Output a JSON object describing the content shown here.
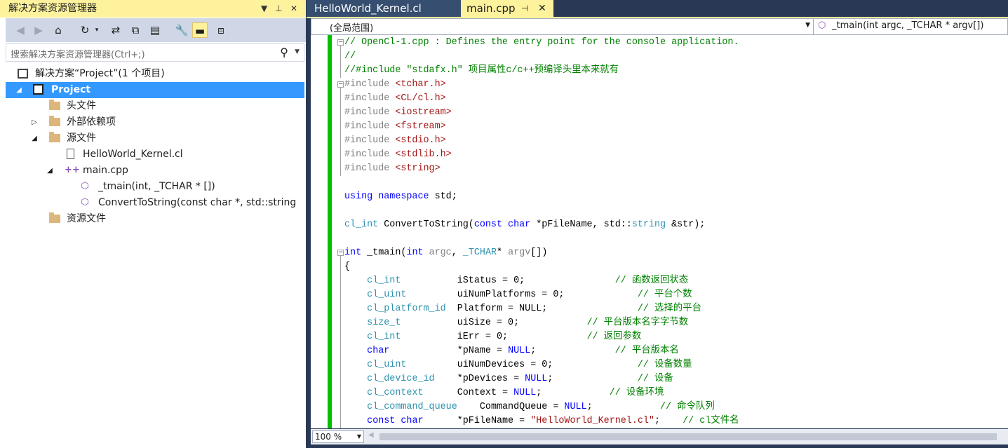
{
  "solution_explorer": {
    "title": "解决方案资源管理器",
    "search_placeholder": "搜索解决方案资源管理器(Ctrl+;)",
    "toolbar_icons": [
      "back-icon",
      "forward-icon",
      "home-icon",
      "history-icon",
      "sync-icon",
      "collapse-all-icon",
      "show-all-files-icon",
      "properties-icon",
      "preview-icon",
      "class-view-icon"
    ],
    "tree": {
      "solution": "解决方案“Project”(1 个项目)",
      "project": "Project",
      "header_files": "头文件",
      "external_deps": "外部依赖项",
      "source_files": "源文件",
      "kernel_file": "HelloWorld_Kernel.cl",
      "main_file": "main.cpp",
      "func_tmain": "_tmain(int, _TCHAR * [])",
      "func_convert": "ConvertToString(const char *, std::string",
      "resource_files": "资源文件"
    }
  },
  "editor": {
    "tabs": [
      {
        "label": "HelloWorld_Kernel.cl",
        "active": false
      },
      {
        "label": "main.cpp",
        "active": true
      }
    ],
    "scope": "(全局范围)",
    "member": "_tmain(int argc, _TCHAR * argv[])",
    "zoom": "100 %"
  },
  "colors": {
    "accent_yellow": "#fff29d",
    "background": "#293955",
    "selection": "#3399ff",
    "change_margin": "#00c000"
  },
  "code_lines": [
    [
      [
        "c",
        "// OpenCl-1.cpp : Defines the entry point for the console application."
      ]
    ],
    [
      [
        "c",
        "//"
      ]
    ],
    [
      [
        "c",
        "//#include \"stdafx.h\" 项目属性c/c++预编译头里本来就有"
      ]
    ],
    [
      [
        "p",
        "#include "
      ],
      [
        "s",
        "<tchar.h>"
      ]
    ],
    [
      [
        "p",
        "#include "
      ],
      [
        "s",
        "<CL/cl.h>"
      ]
    ],
    [
      [
        "p",
        "#include "
      ],
      [
        "s",
        "<iostream>"
      ]
    ],
    [
      [
        "p",
        "#include "
      ],
      [
        "s",
        "<fstream>"
      ]
    ],
    [
      [
        "p",
        "#include "
      ],
      [
        "s",
        "<stdio.h>"
      ]
    ],
    [
      [
        "p",
        "#include "
      ],
      [
        "s",
        "<stdlib.h>"
      ]
    ],
    [
      [
        "p",
        "#include "
      ],
      [
        "s",
        "<string>"
      ]
    ],
    [],
    [
      [
        "k",
        "using namespace"
      ],
      [
        "n",
        " std;"
      ]
    ],
    [],
    [
      [
        "t",
        "cl_int"
      ],
      [
        "n",
        " ConvertToString("
      ],
      [
        "k",
        "const char"
      ],
      [
        "n",
        " *pFileName, std::"
      ],
      [
        "t",
        "string"
      ],
      [
        "n",
        " &str);"
      ]
    ],
    [],
    [
      [
        "k",
        "int"
      ],
      [
        "n",
        " _tmain("
      ],
      [
        "k",
        "int"
      ],
      [
        "n",
        " "
      ],
      [
        "p",
        "argc"
      ],
      [
        "n",
        ", "
      ],
      [
        "t",
        "_TCHAR"
      ],
      [
        "n",
        "* "
      ],
      [
        "p",
        "argv"
      ],
      [
        "n",
        "[])"
      ]
    ],
    [
      [
        "n",
        "{"
      ]
    ],
    [
      [
        "n",
        "    "
      ],
      [
        "t",
        "cl_int"
      ],
      [
        "n",
        "          iStatus = 0;                "
      ],
      [
        "c",
        "// 函数返回状态"
      ]
    ],
    [
      [
        "n",
        "    "
      ],
      [
        "t",
        "cl_uint"
      ],
      [
        "n",
        "         uiNumPlatforms = 0;             "
      ],
      [
        "c",
        "// 平台个数"
      ]
    ],
    [
      [
        "n",
        "    "
      ],
      [
        "t",
        "cl_platform_id"
      ],
      [
        "n",
        "  Platform = NULL;                "
      ],
      [
        "c",
        "// 选择的平台"
      ]
    ],
    [
      [
        "n",
        "    "
      ],
      [
        "t",
        "size_t"
      ],
      [
        "n",
        "          uiSize = 0;            "
      ],
      [
        "c",
        "// 平台版本名字字节数"
      ]
    ],
    [
      [
        "n",
        "    "
      ],
      [
        "t",
        "cl_int"
      ],
      [
        "n",
        "          iErr = 0;              "
      ],
      [
        "c",
        "// 返回参数"
      ]
    ],
    [
      [
        "n",
        "    "
      ],
      [
        "k",
        "char"
      ],
      [
        "n",
        "            *pName = "
      ],
      [
        "k",
        "NULL"
      ],
      [
        "n",
        ";              "
      ],
      [
        "c",
        "// 平台版本名"
      ]
    ],
    [
      [
        "n",
        "    "
      ],
      [
        "t",
        "cl_uint"
      ],
      [
        "n",
        "         uiNumDevices = 0;               "
      ],
      [
        "c",
        "// 设备数量"
      ]
    ],
    [
      [
        "n",
        "    "
      ],
      [
        "t",
        "cl_device_id"
      ],
      [
        "n",
        "    *pDevices = "
      ],
      [
        "k",
        "NULL"
      ],
      [
        "n",
        ";               "
      ],
      [
        "c",
        "// 设备"
      ]
    ],
    [
      [
        "n",
        "    "
      ],
      [
        "t",
        "cl_context"
      ],
      [
        "n",
        "      Context = "
      ],
      [
        "k",
        "NULL"
      ],
      [
        "n",
        ";            "
      ],
      [
        "c",
        "// 设备环境"
      ]
    ],
    [
      [
        "n",
        "    "
      ],
      [
        "t",
        "cl_command_queue"
      ],
      [
        "n",
        "    CommandQueue = "
      ],
      [
        "k",
        "NULL"
      ],
      [
        "n",
        ";            "
      ],
      [
        "c",
        "// 命令队列"
      ]
    ],
    [
      [
        "n",
        "    "
      ],
      [
        "k",
        "const char"
      ],
      [
        "n",
        "      *pFileName = "
      ],
      [
        "s",
        "\"HelloWorld_Kernel.cl\""
      ],
      [
        "n",
        ";    "
      ],
      [
        "c",
        "// cl文件名"
      ]
    ]
  ]
}
